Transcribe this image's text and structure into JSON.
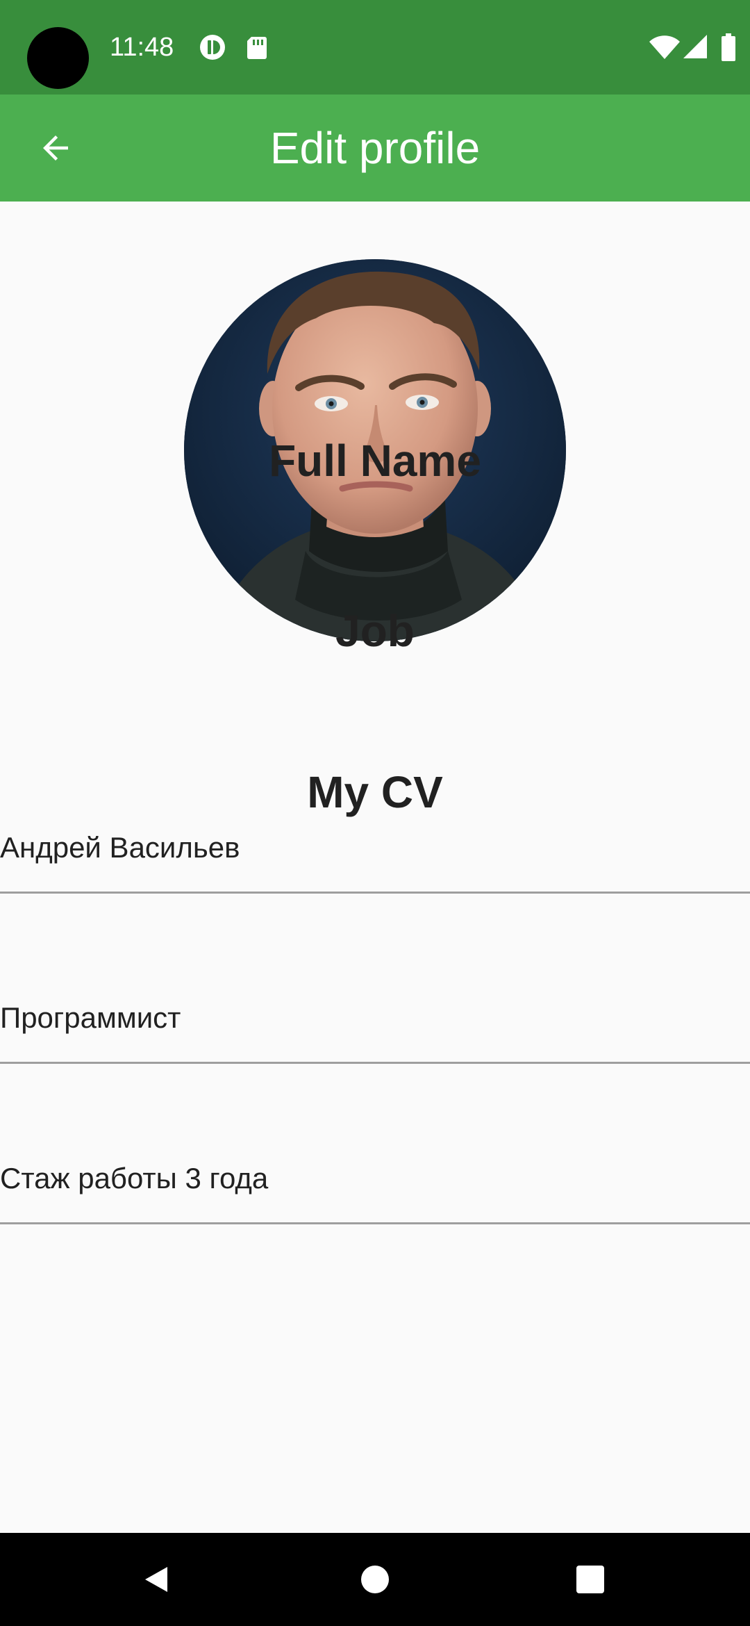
{
  "status_bar": {
    "time": "11:48",
    "left_icons": [
      "data-saver-icon",
      "sd-card-icon"
    ],
    "right_icons": [
      "wifi-icon",
      "cell-signal-icon",
      "battery-icon"
    ],
    "color": "#388e3c"
  },
  "app_bar": {
    "title": "Edit profile",
    "back_icon": "arrow-back-icon",
    "color": "#4caf50"
  },
  "profile": {
    "avatar": "profile-photo",
    "full_name_label": "Full Name",
    "full_name_value": "Андрей Васильев",
    "job_label": "Job",
    "job_value": "Программист",
    "cv_label": "My CV",
    "cv_value": "Стаж работы 3 года"
  },
  "nav_bar": {
    "icons": [
      "back-triangle-icon",
      "home-circle-icon",
      "recents-square-icon"
    ]
  }
}
